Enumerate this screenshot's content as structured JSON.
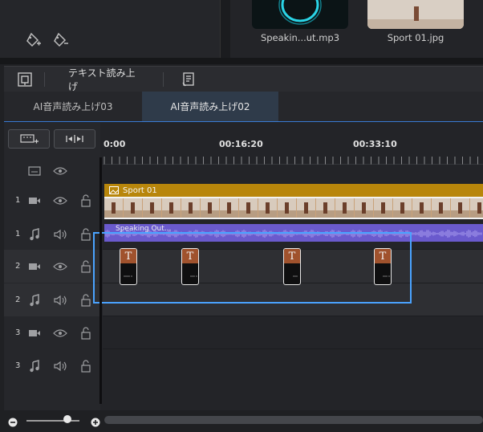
{
  "media_bin": {
    "items": [
      {
        "name": "Speakin...ut.mp3"
      },
      {
        "name": "Sport 01.jpg"
      }
    ]
  },
  "toolbar": {
    "tts_label": "テキスト読み上げ"
  },
  "tabs": [
    {
      "label": "AI音声読み上げ03",
      "active": false
    },
    {
      "label": "AI音声読み上げ02",
      "active": true
    }
  ],
  "ruler": {
    "labels": [
      "0:00",
      "00:16:20",
      "00:33:10"
    ]
  },
  "tracks": [
    {
      "number": "1",
      "type": "video"
    },
    {
      "number": "1",
      "type": "audio"
    },
    {
      "number": "2",
      "type": "video"
    },
    {
      "number": "2",
      "type": "audio"
    },
    {
      "number": "3",
      "type": "video"
    },
    {
      "number": "3",
      "type": "audio"
    }
  ],
  "clips": {
    "sport_title": "Sport 01",
    "audio_title": "Speaking Out...",
    "text_clip_glyph": "T"
  },
  "colors": {
    "accent": "#4aa3ff",
    "video_clip": "#b8860b",
    "audio_clip": "#6a5acd",
    "text_clip": "#a0522d"
  }
}
